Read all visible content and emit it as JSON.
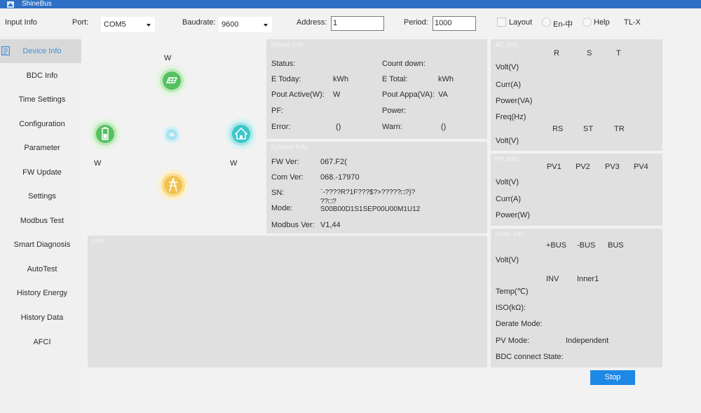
{
  "app": {
    "title": "ShineBus"
  },
  "input_bar": {
    "section_label": "Input Info",
    "port_label": "Port:",
    "port_value": "COM5",
    "baudrate_label": "Baudrate:",
    "baudrate_value": "9600",
    "address_label": "Address:",
    "address_value": "1",
    "period_label": "Period:",
    "period_value": "1000",
    "layout_label": "Layout",
    "language_label": "En-中",
    "help_label": "Help",
    "model_label": "TL-X"
  },
  "sidebar": {
    "items": [
      {
        "label": "Device Info",
        "active": true
      },
      {
        "label": "BDC Info"
      },
      {
        "label": "Time Settings"
      },
      {
        "label": "Configuration"
      },
      {
        "label": "Parameter"
      },
      {
        "label": "FW Update"
      },
      {
        "label": "Settings"
      },
      {
        "label": "Modbus Test"
      },
      {
        "label": "Smart Diagnosis"
      },
      {
        "label": "AutoTest"
      },
      {
        "label": "History Energy"
      },
      {
        "label": "History Data"
      },
      {
        "label": "AFCI"
      }
    ]
  },
  "diagram": {
    "pv_unit": "W",
    "battery_unit": "W",
    "load_unit": "W"
  },
  "status_info": {
    "title": "Status Info",
    "status_label": "Status:",
    "countdown_label": "Count down:",
    "etoday_label": "E Today:",
    "etoday_unit": "kWh",
    "etotal_label": "E Total:",
    "etotal_unit": "kWh",
    "pout_active_label": "Pout Active(W):",
    "pout_active_unit": "W",
    "pout_appa_label": "Pout Appa(VA):",
    "pout_appa_unit": "VA",
    "pf_label": "PF:",
    "power_label": "Power:",
    "error_label": "Error:",
    "error_value": "()",
    "warn_label": "Warn:",
    "warn_value": "()"
  },
  "system_info": {
    "title": "System Info",
    "fw_label": "FW Ver:",
    "fw_value": "067.F2(",
    "com_label": "Com Ver:",
    "com_value": "068.-17970",
    "sn_label": "SN:",
    "sn_value": "`-????R?1F???$?>?????□?}?",
    "sn_value2": "??□?",
    "mode_label": "Mode:",
    "mode_value": "S00B00D1S1SEP00U00M1U12",
    "modbus_label": "Modbus Ver:",
    "modbus_value": "V1,44"
  },
  "info_panel": {
    "title": "Info"
  },
  "ac_info": {
    "title": "AC Info",
    "col_r": "R",
    "col_s": "S",
    "col_t": "T",
    "volt_label": "Volt(V)",
    "curr_label": "Curr(A)",
    "power_label": "Power(VA)",
    "freq_label": "Freq(Hz)",
    "col_rs": "RS",
    "col_st": "ST",
    "col_tr": "TR",
    "volt2_label": "Volt(V)"
  },
  "pv_info": {
    "title": "PV Info",
    "cols": [
      "PV1",
      "PV2",
      "PV3",
      "PV4"
    ],
    "volt_label": "Volt(V)",
    "curr_label": "Curr(A)",
    "power_label": "Power(W)"
  },
  "inner_info": {
    "title": "Inner Info",
    "col_pbus": "+BUS",
    "col_nbus": "-BUS",
    "col_bus": "BUS",
    "volt_label": "Volt(V)",
    "col_inv": "INV",
    "col_inner1": "Inner1",
    "temp_label": "Temp(℃)",
    "iso_label": "ISO(kΩ):",
    "derate_label": "Derate Mode:",
    "pvmode_label": "PV Mode:",
    "pvmode_value": "Independent",
    "bdc_label": "BDC connect State:"
  },
  "buttons": {
    "stop": "Stop"
  },
  "colors": {
    "accent": "#1e88e5",
    "titlebar": "#2d6fc4",
    "active_nav_text": "#3f8fde"
  }
}
